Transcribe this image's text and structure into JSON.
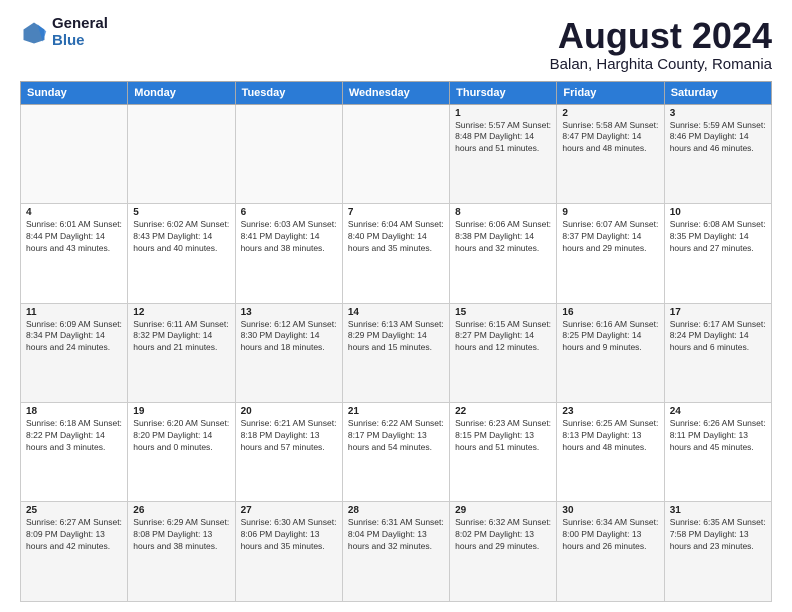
{
  "logo": {
    "general": "General",
    "blue": "Blue"
  },
  "title": {
    "month_year": "August 2024",
    "location": "Balan, Harghita County, Romania"
  },
  "headers": [
    "Sunday",
    "Monday",
    "Tuesday",
    "Wednesday",
    "Thursday",
    "Friday",
    "Saturday"
  ],
  "weeks": [
    [
      {
        "day": "",
        "info": ""
      },
      {
        "day": "",
        "info": ""
      },
      {
        "day": "",
        "info": ""
      },
      {
        "day": "",
        "info": ""
      },
      {
        "day": "1",
        "info": "Sunrise: 5:57 AM\nSunset: 8:48 PM\nDaylight: 14 hours\nand 51 minutes."
      },
      {
        "day": "2",
        "info": "Sunrise: 5:58 AM\nSunset: 8:47 PM\nDaylight: 14 hours\nand 48 minutes."
      },
      {
        "day": "3",
        "info": "Sunrise: 5:59 AM\nSunset: 8:46 PM\nDaylight: 14 hours\nand 46 minutes."
      }
    ],
    [
      {
        "day": "4",
        "info": "Sunrise: 6:01 AM\nSunset: 8:44 PM\nDaylight: 14 hours\nand 43 minutes."
      },
      {
        "day": "5",
        "info": "Sunrise: 6:02 AM\nSunset: 8:43 PM\nDaylight: 14 hours\nand 40 minutes."
      },
      {
        "day": "6",
        "info": "Sunrise: 6:03 AM\nSunset: 8:41 PM\nDaylight: 14 hours\nand 38 minutes."
      },
      {
        "day": "7",
        "info": "Sunrise: 6:04 AM\nSunset: 8:40 PM\nDaylight: 14 hours\nand 35 minutes."
      },
      {
        "day": "8",
        "info": "Sunrise: 6:06 AM\nSunset: 8:38 PM\nDaylight: 14 hours\nand 32 minutes."
      },
      {
        "day": "9",
        "info": "Sunrise: 6:07 AM\nSunset: 8:37 PM\nDaylight: 14 hours\nand 29 minutes."
      },
      {
        "day": "10",
        "info": "Sunrise: 6:08 AM\nSunset: 8:35 PM\nDaylight: 14 hours\nand 27 minutes."
      }
    ],
    [
      {
        "day": "11",
        "info": "Sunrise: 6:09 AM\nSunset: 8:34 PM\nDaylight: 14 hours\nand 24 minutes."
      },
      {
        "day": "12",
        "info": "Sunrise: 6:11 AM\nSunset: 8:32 PM\nDaylight: 14 hours\nand 21 minutes."
      },
      {
        "day": "13",
        "info": "Sunrise: 6:12 AM\nSunset: 8:30 PM\nDaylight: 14 hours\nand 18 minutes."
      },
      {
        "day": "14",
        "info": "Sunrise: 6:13 AM\nSunset: 8:29 PM\nDaylight: 14 hours\nand 15 minutes."
      },
      {
        "day": "15",
        "info": "Sunrise: 6:15 AM\nSunset: 8:27 PM\nDaylight: 14 hours\nand 12 minutes."
      },
      {
        "day": "16",
        "info": "Sunrise: 6:16 AM\nSunset: 8:25 PM\nDaylight: 14 hours\nand 9 minutes."
      },
      {
        "day": "17",
        "info": "Sunrise: 6:17 AM\nSunset: 8:24 PM\nDaylight: 14 hours\nand 6 minutes."
      }
    ],
    [
      {
        "day": "18",
        "info": "Sunrise: 6:18 AM\nSunset: 8:22 PM\nDaylight: 14 hours\nand 3 minutes."
      },
      {
        "day": "19",
        "info": "Sunrise: 6:20 AM\nSunset: 8:20 PM\nDaylight: 14 hours\nand 0 minutes."
      },
      {
        "day": "20",
        "info": "Sunrise: 6:21 AM\nSunset: 8:18 PM\nDaylight: 13 hours\nand 57 minutes."
      },
      {
        "day": "21",
        "info": "Sunrise: 6:22 AM\nSunset: 8:17 PM\nDaylight: 13 hours\nand 54 minutes."
      },
      {
        "day": "22",
        "info": "Sunrise: 6:23 AM\nSunset: 8:15 PM\nDaylight: 13 hours\nand 51 minutes."
      },
      {
        "day": "23",
        "info": "Sunrise: 6:25 AM\nSunset: 8:13 PM\nDaylight: 13 hours\nand 48 minutes."
      },
      {
        "day": "24",
        "info": "Sunrise: 6:26 AM\nSunset: 8:11 PM\nDaylight: 13 hours\nand 45 minutes."
      }
    ],
    [
      {
        "day": "25",
        "info": "Sunrise: 6:27 AM\nSunset: 8:09 PM\nDaylight: 13 hours\nand 42 minutes."
      },
      {
        "day": "26",
        "info": "Sunrise: 6:29 AM\nSunset: 8:08 PM\nDaylight: 13 hours\nand 38 minutes."
      },
      {
        "day": "27",
        "info": "Sunrise: 6:30 AM\nSunset: 8:06 PM\nDaylight: 13 hours\nand 35 minutes."
      },
      {
        "day": "28",
        "info": "Sunrise: 6:31 AM\nSunset: 8:04 PM\nDaylight: 13 hours\nand 32 minutes."
      },
      {
        "day": "29",
        "info": "Sunrise: 6:32 AM\nSunset: 8:02 PM\nDaylight: 13 hours\nand 29 minutes."
      },
      {
        "day": "30",
        "info": "Sunrise: 6:34 AM\nSunset: 8:00 PM\nDaylight: 13 hours\nand 26 minutes."
      },
      {
        "day": "31",
        "info": "Sunrise: 6:35 AM\nSunset: 7:58 PM\nDaylight: 13 hours\nand 23 minutes."
      }
    ]
  ]
}
